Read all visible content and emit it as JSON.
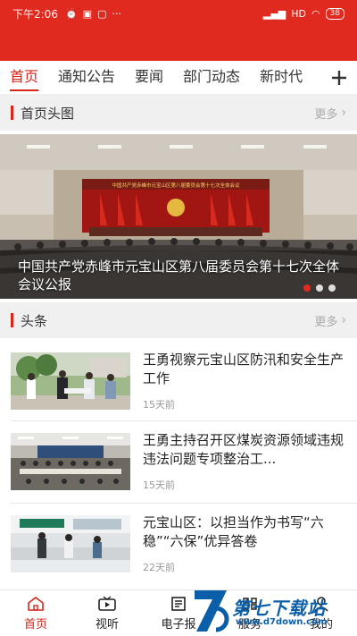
{
  "status": {
    "time": "下午2:06",
    "left_icons": [
      "alarm-icon",
      "nfc-icon",
      "image-icon",
      "more-dots-icon"
    ],
    "network": "HD",
    "battery": "38"
  },
  "tabs": [
    "首页",
    "通知公告",
    "要闻",
    "部门动态",
    "新时代"
  ],
  "sections": {
    "banner": {
      "title": "首页头图",
      "more": "更多"
    },
    "headline": {
      "title": "头条",
      "more": "更多"
    }
  },
  "banner": {
    "stage_text": "中国共产党赤峰市元宝山区第八届委员会第十七次全体会议",
    "caption": "中国共产党赤峰市元宝山区第八届委员会第十七次全体会议公报",
    "dots": 3,
    "active_dot": 0
  },
  "news": [
    {
      "title": "王勇视察元宝山区防汛和安全生产工作",
      "time": "15天前"
    },
    {
      "title": "王勇主持召开区煤炭资源领域违规违法问题专项整治工...",
      "time": "15天前"
    },
    {
      "title": "元宝山区：以担当作为书写“六稳”“六保”优异答卷",
      "time": "22天前"
    }
  ],
  "bottom_nav": [
    {
      "label": "首页",
      "icon": "home-icon",
      "active": true
    },
    {
      "label": "视听",
      "icon": "tv-icon",
      "active": false
    },
    {
      "label": "电子报",
      "icon": "newspaper-icon",
      "active": false
    },
    {
      "label": "服务",
      "icon": "service-icon",
      "active": false
    },
    {
      "label": "我的",
      "icon": "user-icon",
      "active": false
    }
  ],
  "watermark": {
    "name": "第七下载站",
    "url": "www.d7down.com"
  },
  "colors": {
    "brand_red": "#e02a1f",
    "text_red": "#d6261c",
    "watermark_blue": "#0b5fa8"
  }
}
